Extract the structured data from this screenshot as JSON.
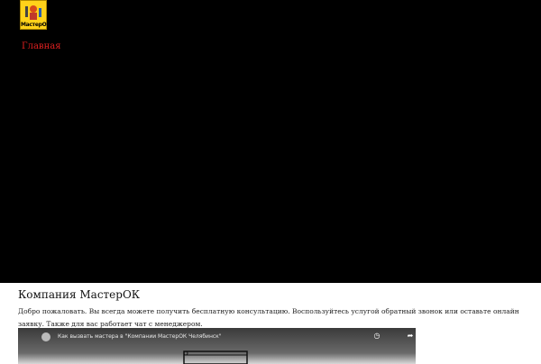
{
  "header": {
    "logo_text": "МастерОК",
    "nav": [
      {
        "label": "Главная"
      }
    ]
  },
  "main": {
    "title": "Компания МастерОК",
    "intro": "Добро пожаловать. Вы всегда можете получить бесплатную консультацию. Воспользуйтесь услугой обратный звонок или оставьте онлайн заявку. Также для вас работает чат с менеджером."
  },
  "video": {
    "title": "Как вызвать мастера в \"Компании МастерОК Челябинск\"",
    "icons": [
      "channel-avatar-icon",
      "clock-icon",
      "share-icon"
    ]
  },
  "colors": {
    "hero_background": "#000000",
    "nav_active": "#e02020",
    "logo_background": "#ffd21a"
  }
}
